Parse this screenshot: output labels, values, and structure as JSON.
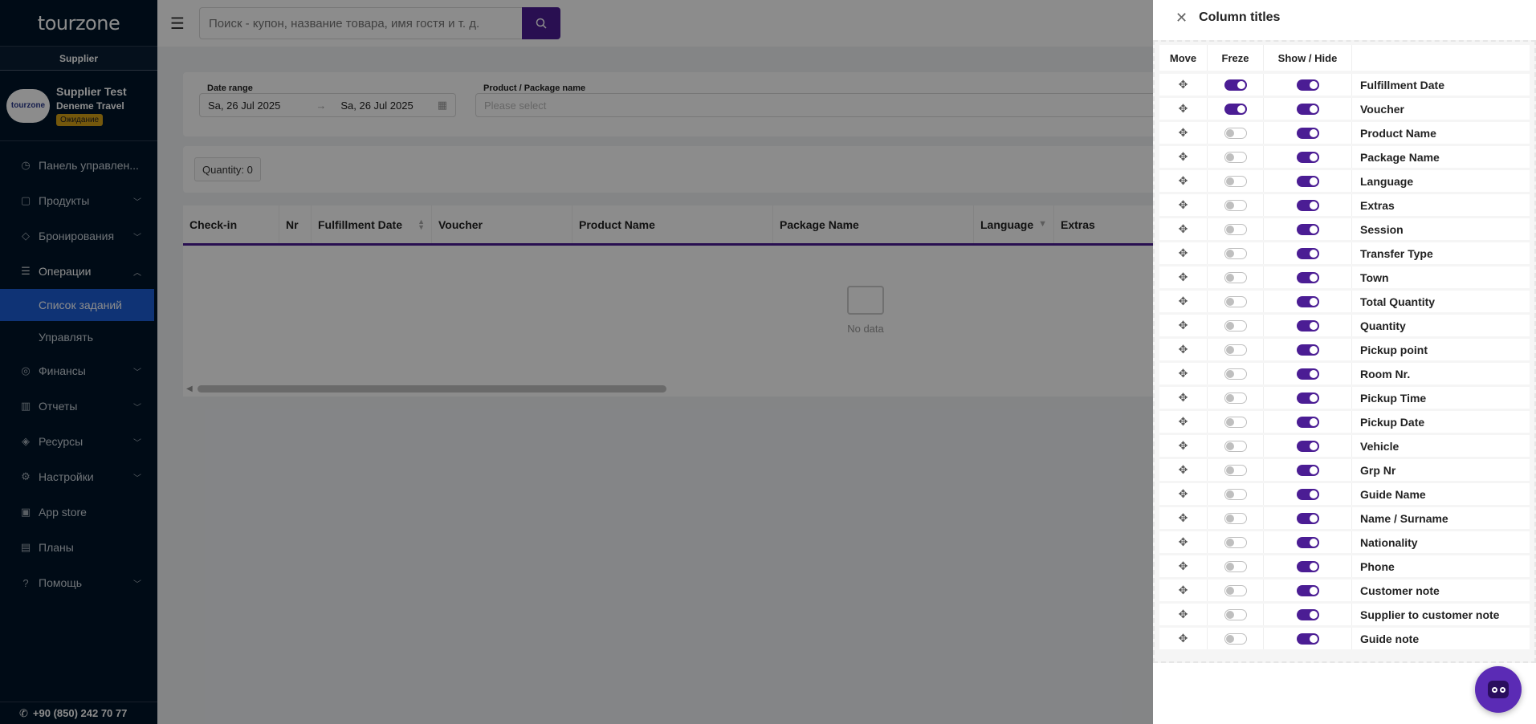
{
  "sidebar": {
    "logo": "tourzone",
    "role": "Supplier",
    "profile": {
      "name": "Supplier Test",
      "company": "Deneme Travel",
      "badge": "Ожидание",
      "avatar_text": "tourzone"
    },
    "menu": [
      {
        "label": "Панель управлен...",
        "icon": "dashboard-icon",
        "has_chevron": false
      },
      {
        "label": "Продукты",
        "icon": "bag-icon",
        "has_chevron": true
      },
      {
        "label": "Бронирования",
        "icon": "tag-icon",
        "has_chevron": true
      },
      {
        "label": "Операции",
        "icon": "list-icon",
        "has_chevron": true,
        "open": true
      }
    ],
    "submenu": [
      {
        "label": "Список заданий",
        "active": true
      },
      {
        "label": "Управлять",
        "active": false
      }
    ],
    "menu_after": [
      {
        "label": "Финансы",
        "icon": "finance-icon",
        "has_chevron": true
      },
      {
        "label": "Отчеты",
        "icon": "chart-icon",
        "has_chevron": true
      },
      {
        "label": "Ресурсы",
        "icon": "resources-icon",
        "has_chevron": true
      },
      {
        "label": "Настройки",
        "icon": "settings-icon",
        "has_chevron": true
      },
      {
        "label": "App store",
        "icon": "apps-icon",
        "has_chevron": false
      },
      {
        "label": "Планы",
        "icon": "plans-icon",
        "has_chevron": false
      },
      {
        "label": "Помощь",
        "icon": "help-icon",
        "has_chevron": true
      }
    ],
    "phone": "+90 (850) 242 70 77"
  },
  "header": {
    "search_placeholder": "Поиск - купон, название товара, имя гостя и т. д."
  },
  "filters": {
    "date_range_label": "Date range",
    "date_start": "Sa, 26 Jul 2025",
    "date_end": "Sa, 26 Jul 2025",
    "product_label": "Product / Package name",
    "product_placeholder": "Please select"
  },
  "quantity_label": "Quantity: 0",
  "table": {
    "columns": [
      {
        "label": "Check-in",
        "width": 120
      },
      {
        "label": "Nr",
        "width": 40
      },
      {
        "label": "Fulfillment Date",
        "width": 150
      },
      {
        "label": "Voucher",
        "width": 175
      },
      {
        "label": "Product Name",
        "width": 250
      },
      {
        "label": "Package Name",
        "width": 250
      },
      {
        "label": "Language",
        "width": 100
      },
      {
        "label": "Extras",
        "width": 615
      }
    ],
    "empty_text": "No data"
  },
  "drawer": {
    "title": "Column titles",
    "headers": {
      "move": "Move",
      "freeze": "Freze",
      "show": "Show / Hide"
    },
    "rows": [
      {
        "name": "Fulfillment Date",
        "freeze": true,
        "show": true
      },
      {
        "name": "Voucher",
        "freeze": true,
        "show": true
      },
      {
        "name": "Product Name",
        "freeze": false,
        "show": true
      },
      {
        "name": "Package Name",
        "freeze": false,
        "show": true
      },
      {
        "name": "Language",
        "freeze": false,
        "show": true
      },
      {
        "name": "Extras",
        "freeze": false,
        "show": true
      },
      {
        "name": "Session",
        "freeze": false,
        "show": true
      },
      {
        "name": "Transfer Type",
        "freeze": false,
        "show": true
      },
      {
        "name": "Town",
        "freeze": false,
        "show": true
      },
      {
        "name": "Total Quantity",
        "freeze": false,
        "show": true
      },
      {
        "name": "Quantity",
        "freeze": false,
        "show": true
      },
      {
        "name": "Pickup point",
        "freeze": false,
        "show": true
      },
      {
        "name": "Room Nr.",
        "freeze": false,
        "show": true
      },
      {
        "name": "Pickup Time",
        "freeze": false,
        "show": true
      },
      {
        "name": "Pickup Date",
        "freeze": false,
        "show": true
      },
      {
        "name": "Vehicle",
        "freeze": false,
        "show": true
      },
      {
        "name": "Grp Nr",
        "freeze": false,
        "show": true
      },
      {
        "name": "Guide Name",
        "freeze": false,
        "show": true
      },
      {
        "name": "Name / Surname",
        "freeze": false,
        "show": true
      },
      {
        "name": "Nationality",
        "freeze": false,
        "show": true
      },
      {
        "name": "Phone",
        "freeze": false,
        "show": true
      },
      {
        "name": "Customer note",
        "freeze": false,
        "show": true
      },
      {
        "name": "Supplier to customer note",
        "freeze": false,
        "show": true
      },
      {
        "name": "Guide note",
        "freeze": false,
        "show": true
      }
    ]
  },
  "colors": {
    "primary": "#4b1d94",
    "sidebar_bg": "#001529",
    "active_menu": "#1c5ed6",
    "badge": "#d4a017"
  }
}
